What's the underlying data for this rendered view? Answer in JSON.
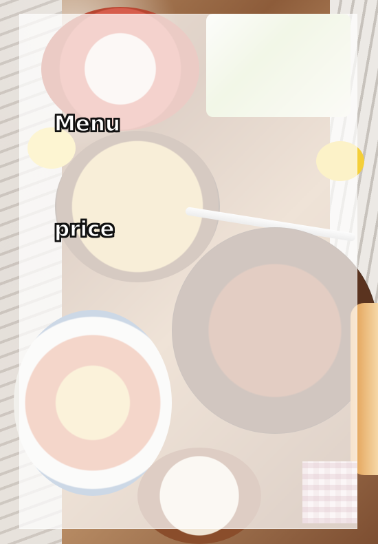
{
  "menu_card": {
    "title": "Menu",
    "price_label": "price"
  }
}
